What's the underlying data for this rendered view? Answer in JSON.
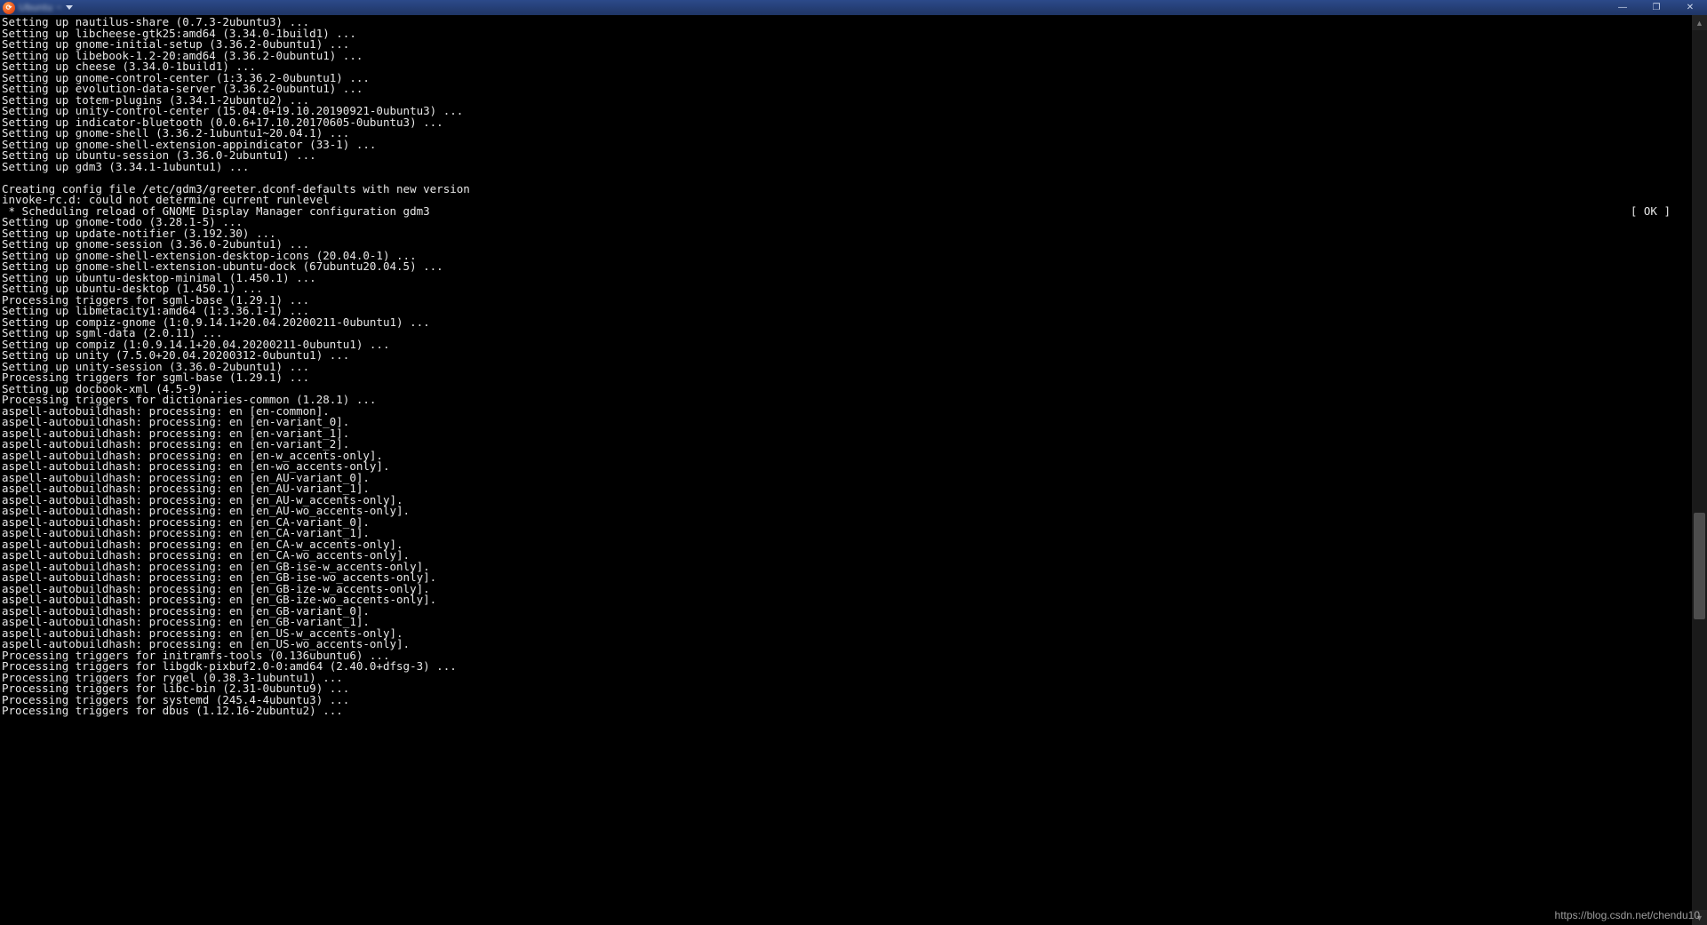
{
  "window": {
    "icon_glyph": "⟳",
    "title_blur": "Ubuntu ~",
    "minimize_glyph": "—",
    "maximize_glyph": "❐",
    "close_glyph": "✕"
  },
  "ok_tag": "[ OK ]",
  "watermark": "https://blog.csdn.net/chendu10",
  "lines": [
    "Setting up nautilus-share (0.7.3-2ubuntu3) ...",
    "Setting up libcheese-gtk25:amd64 (3.34.0-1build1) ...",
    "Setting up gnome-initial-setup (3.36.2-0ubuntu1) ...",
    "Setting up libebook-1.2-20:amd64 (3.36.2-0ubuntu1) ...",
    "Setting up cheese (3.34.0-1build1) ...",
    "Setting up gnome-control-center (1:3.36.2-0ubuntu1) ...",
    "Setting up evolution-data-server (3.36.2-0ubuntu1) ...",
    "Setting up totem-plugins (3.34.1-2ubuntu2) ...",
    "Setting up unity-control-center (15.04.0+19.10.20190921-0ubuntu3) ...",
    "Setting up indicator-bluetooth (0.0.6+17.10.20170605-0ubuntu3) ...",
    "Setting up gnome-shell (3.36.2-1ubuntu1~20.04.1) ...",
    "Setting up gnome-shell-extension-appindicator (33-1) ...",
    "Setting up ubuntu-session (3.36.0-2ubuntu1) ...",
    "Setting up gdm3 (3.34.1-1ubuntu1) ...",
    "",
    "Creating config file /etc/gdm3/greeter.dconf-defaults with new version",
    "invoke-rc.d: could not determine current runlevel",
    {
      "left": " * Scheduling reload of GNOME Display Manager configuration gdm3",
      "right_ok": true
    },
    "Setting up gnome-todo (3.28.1-5) ...",
    "Setting up update-notifier (3.192.30) ...",
    "Setting up gnome-session (3.36.0-2ubuntu1) ...",
    "Setting up gnome-shell-extension-desktop-icons (20.04.0-1) ...",
    "Setting up gnome-shell-extension-ubuntu-dock (67ubuntu20.04.5) ...",
    "Setting up ubuntu-desktop-minimal (1.450.1) ...",
    "Setting up ubuntu-desktop (1.450.1) ...",
    "Processing triggers for sgml-base (1.29.1) ...",
    "Setting up libmetacity1:amd64 (1:3.36.1-1) ...",
    "Setting up compiz-gnome (1:0.9.14.1+20.04.20200211-0ubuntu1) ...",
    "Setting up sgml-data (2.0.11) ...",
    "Setting up compiz (1:0.9.14.1+20.04.20200211-0ubuntu1) ...",
    "Setting up unity (7.5.0+20.04.20200312-0ubuntu1) ...",
    "Setting up unity-session (3.36.0-2ubuntu1) ...",
    "Processing triggers for sgml-base (1.29.1) ...",
    "Setting up docbook-xml (4.5-9) ...",
    "Processing triggers for dictionaries-common (1.28.1) ...",
    "aspell-autobuildhash: processing: en [en-common].",
    "aspell-autobuildhash: processing: en [en-variant_0].",
    "aspell-autobuildhash: processing: en [en-variant_1].",
    "aspell-autobuildhash: processing: en [en-variant_2].",
    "aspell-autobuildhash: processing: en [en-w_accents-only].",
    "aspell-autobuildhash: processing: en [en-wo_accents-only].",
    "aspell-autobuildhash: processing: en [en_AU-variant_0].",
    "aspell-autobuildhash: processing: en [en_AU-variant_1].",
    "aspell-autobuildhash: processing: en [en_AU-w_accents-only].",
    "aspell-autobuildhash: processing: en [en_AU-wo_accents-only].",
    "aspell-autobuildhash: processing: en [en_CA-variant_0].",
    "aspell-autobuildhash: processing: en [en_CA-variant_1].",
    "aspell-autobuildhash: processing: en [en_CA-w_accents-only].",
    "aspell-autobuildhash: processing: en [en_CA-wo_accents-only].",
    "aspell-autobuildhash: processing: en [en_GB-ise-w_accents-only].",
    "aspell-autobuildhash: processing: en [en_GB-ise-wo_accents-only].",
    "aspell-autobuildhash: processing: en [en_GB-ize-w_accents-only].",
    "aspell-autobuildhash: processing: en [en_GB-ize-wo_accents-only].",
    "aspell-autobuildhash: processing: en [en_GB-variant_0].",
    "aspell-autobuildhash: processing: en [en_GB-variant_1].",
    "aspell-autobuildhash: processing: en [en_US-w_accents-only].",
    "aspell-autobuildhash: processing: en [en_US-wo_accents-only].",
    "Processing triggers for initramfs-tools (0.136ubuntu6) ...",
    "Processing triggers for libgdk-pixbuf2.0-0:amd64 (2.40.0+dfsg-3) ...",
    "Processing triggers for rygel (0.38.3-1ubuntu1) ...",
    "Processing triggers for libc-bin (2.31-0ubuntu9) ...",
    "Processing triggers for systemd (245.4-4ubuntu3) ...",
    "Processing triggers for dbus (1.12.16-2ubuntu2) ..."
  ]
}
